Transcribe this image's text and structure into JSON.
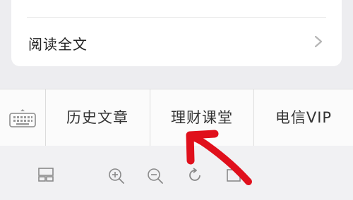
{
  "article_card": {
    "read_full_text_label": "阅读全文"
  },
  "menu": {
    "keyboard_icon": "keyboard-icon",
    "items": [
      {
        "label": "历史文章"
      },
      {
        "label": "理财课堂"
      },
      {
        "label": "电信VIP"
      }
    ]
  },
  "bottom_toolbar": {
    "icons": [
      "split-window-icon",
      "zoom-in-icon",
      "zoom-out-icon",
      "refresh-icon",
      "window-icon"
    ]
  },
  "colors": {
    "annotation_arrow": "#e0101c"
  }
}
